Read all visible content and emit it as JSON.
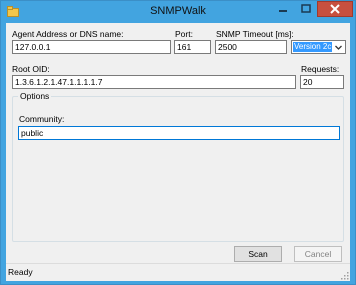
{
  "window": {
    "title": "SNMPWalk"
  },
  "controls": {
    "minimize_icon": "minimize-icon",
    "maximize_icon": "maximize-icon",
    "close_icon": "close-icon"
  },
  "form": {
    "agent_label": "Agent Address or DNS name:",
    "agent_value": "127.0.0.1",
    "port_label": "Port:",
    "port_value": "161",
    "timeout_label": "SNMP Timeout [ms]:",
    "timeout_value": "2500",
    "version_value": "Version 2c",
    "root_oid_label": "Root OID:",
    "root_oid_value": "1.3.6.1.2.1.47.1.1.1.1.7",
    "requests_label": "Requests:",
    "requests_value": "20"
  },
  "options": {
    "group_label": "Options",
    "community_label": "Community:",
    "community_value": "public"
  },
  "buttons": {
    "scan_label": "Scan",
    "cancel_label": "Cancel"
  },
  "status": {
    "text": "Ready"
  },
  "colors": {
    "titlebar": "#42a4e0",
    "close_button": "#c7503f",
    "selection": "#3399ff",
    "focus_border": "#0078d7"
  }
}
